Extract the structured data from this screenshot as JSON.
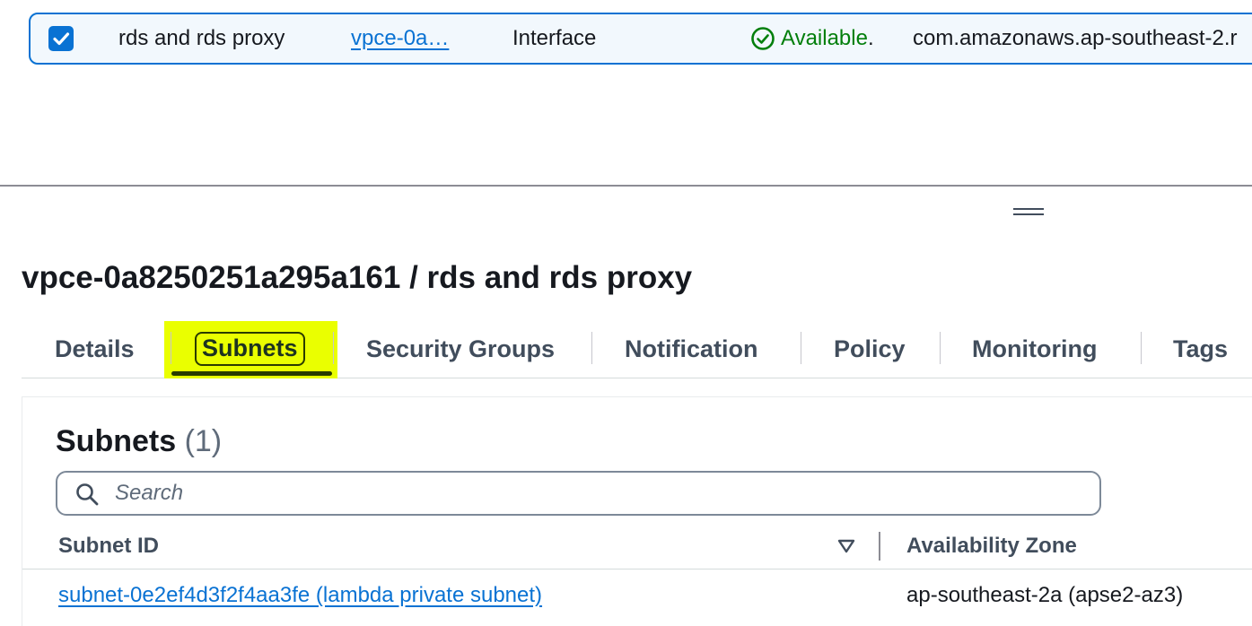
{
  "endpoint_row": {
    "selected": true,
    "name": "rds and rds proxy",
    "id_truncated": "vpce-0a…",
    "type": "Interface",
    "status": "Available",
    "status_trailing": ".",
    "service": "com.amazonaws.ap-southeast-2.r",
    "status_icon": "check-circle-icon",
    "colors": {
      "link": "#0972d3",
      "status_ok": "#037f0c",
      "highlight": "#eaff00"
    }
  },
  "detail": {
    "title": "vpce-0a8250251a295a161 / rds and rds proxy"
  },
  "tabs": [
    {
      "label": "Details",
      "active": false
    },
    {
      "label": "Subnets",
      "active": true
    },
    {
      "label": "Security Groups",
      "active": false
    },
    {
      "label": "Notification",
      "active": false
    },
    {
      "label": "Policy",
      "active": false
    },
    {
      "label": "Monitoring",
      "active": false
    },
    {
      "label": "Tags",
      "active": false
    }
  ],
  "subnets": {
    "title": "Subnets",
    "count": "(1)",
    "search": {
      "placeholder": "Search",
      "icon": "search-icon"
    },
    "columns": [
      {
        "label": "Subnet ID",
        "sort_icon": "sort-down-icon"
      },
      {
        "label": "Availability Zone"
      }
    ],
    "rows": [
      {
        "subnet_id": "subnet-0e2ef4d3f2f4aa3fe (lambda private subnet)",
        "availability_zone": "ap-southeast-2a (apse2-az3)"
      }
    ]
  }
}
